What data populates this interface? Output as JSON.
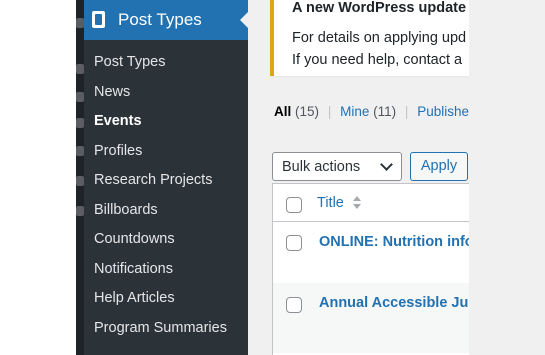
{
  "sidebar": {
    "menu_title": "Post Types",
    "items": [
      {
        "label": "Post Types",
        "current": false
      },
      {
        "label": "News",
        "current": false
      },
      {
        "label": "Events",
        "current": true
      },
      {
        "label": "Profiles",
        "current": false
      },
      {
        "label": "Research Projects",
        "current": false
      },
      {
        "label": "Billboards",
        "current": false
      },
      {
        "label": "Countdowns",
        "current": false
      },
      {
        "label": "Notifications",
        "current": false
      },
      {
        "label": "Help Articles",
        "current": false
      },
      {
        "label": "Program Summaries",
        "current": false
      }
    ]
  },
  "notice": {
    "title": "A new WordPress update",
    "line1": "For details on applying upd",
    "line2": "If you need help, contact a"
  },
  "filters": {
    "all_label": "All",
    "all_count": "(15)",
    "mine_label": "Mine",
    "mine_count": "(11)",
    "published_label": "Published",
    "separator": "|"
  },
  "bulk": {
    "select_value": "Bulk actions",
    "apply_label": "Apply"
  },
  "table": {
    "column_title": "Title",
    "rows": [
      {
        "title": "ONLINE: Nutrition info"
      },
      {
        "title": "Annual Accessible Ju"
      }
    ]
  },
  "colors": {
    "sidebar_bg": "#2c3338",
    "active_menu": "#2271b1",
    "link": "#2271b1",
    "notice_border": "#dba617"
  }
}
